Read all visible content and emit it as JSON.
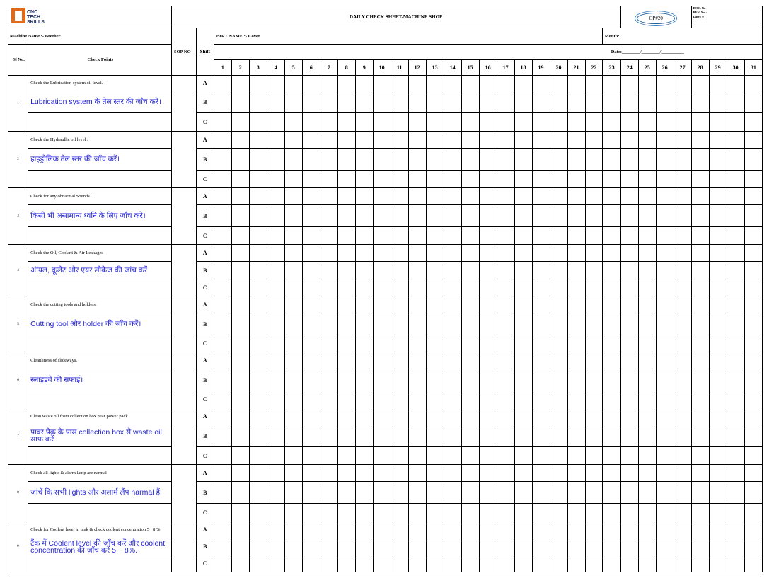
{
  "header": {
    "logo_text": "CNC TECH SKILLS",
    "title": "DAILY CHECK SHEET-MACHINE SHOP",
    "op_label": "OP#20",
    "doc_no_label": "DOC. No   :",
    "rev_no_label": "REV. No   :",
    "date_label": "Date          : 0"
  },
  "info": {
    "machine_name": "Machine Name :-  Brother",
    "sop_no": "SOP NO -",
    "shift": "Shift",
    "part_name": "PART NAME :-  Cover",
    "month": "Month:",
    "date_line": "Date:________/________/__________"
  },
  "columns": {
    "sl_no": "Sl No.",
    "check_points": "Check Points",
    "days": [
      "1",
      "2",
      "3",
      "4",
      "5",
      "6",
      "7",
      "8",
      "9",
      "10",
      "11",
      "12",
      "13",
      "14",
      "15",
      "16",
      "17",
      "18",
      "19",
      "20",
      "21",
      "22",
      "23",
      "24",
      "25",
      "26",
      "27",
      "28",
      "29",
      "30",
      "31"
    ]
  },
  "shifts": [
    "A",
    "B",
    "C"
  ],
  "check_points": [
    {
      "sl": "1",
      "en": "Check the Lubrication system oil level.",
      "hi": "Lubrication system के तेल स्तर की जाँच करें।"
    },
    {
      "sl": "2",
      "en": "Check the Hydraullic oil level .",
      "hi": "हाइड्रोलिक तेल स्तर की जाँच करें।"
    },
    {
      "sl": "3",
      "en": "Check for any obnarmal Sounds .",
      "hi": "किसी भी असामान्य ध्वनि के लिए जाँच करें।"
    },
    {
      "sl": "4",
      "en": "Check the Oil, Coolant  &  Air Leakages",
      "hi": "ऑयल, कूलेंट और एयर लीकेज की जांच करें"
    },
    {
      "sl": "5",
      "en": "Check the cutting tools and holders.",
      "hi": "Cutting tool और holder की जाँच करें।"
    },
    {
      "sl": "6",
      "en": "Cleanliness of slideways.",
      "hi": "स्लाइडवे की सफाई।"
    },
    {
      "sl": "7",
      "en": "Clean waste oil from collection  box near power pack",
      "hi": "पावर पैक के पास collection  box से waste oil साफ करें."
    },
    {
      "sl": "8",
      "en": "Check all lights & alarm lamp are narmal",
      "hi": "जांचें कि सभी  lights और अलार्म लैंप narmal हैं."
    },
    {
      "sl": "9",
      "en": "Check for  Coolent  level in tank & check coolent concentration 5~ 8 %",
      "hi": "टैंक में Coolent  level की जाँच करें और coolent concentration की जाँच करें 5 ~ 8%."
    }
  ]
}
